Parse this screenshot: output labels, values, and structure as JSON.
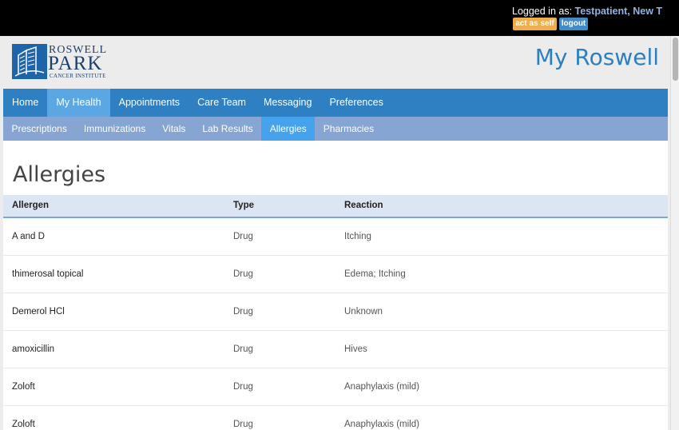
{
  "session": {
    "logged_in_label": "Logged in as:",
    "user_name": "Testpatient, New T",
    "act_as_self_label": "act as self",
    "logout_label": "logout"
  },
  "logo": {
    "line1": "ROSWELL",
    "line2": "PARK",
    "line3": "CANCER INSTITUTE"
  },
  "site_title": "My Roswell",
  "nav_primary": [
    {
      "label": "Home",
      "active": false
    },
    {
      "label": "My Health",
      "active": true
    },
    {
      "label": "Appointments",
      "active": false
    },
    {
      "label": "Care Team",
      "active": false
    },
    {
      "label": "Messaging",
      "active": false
    },
    {
      "label": "Preferences",
      "active": false
    }
  ],
  "nav_secondary": [
    {
      "label": "Prescriptions",
      "active": false
    },
    {
      "label": "Immunizations",
      "active": false
    },
    {
      "label": "Vitals",
      "active": false
    },
    {
      "label": "Lab Results",
      "active": false
    },
    {
      "label": "Allergies",
      "active": true
    },
    {
      "label": "Pharmacies",
      "active": false
    }
  ],
  "page_title": "Allergies",
  "table": {
    "headers": {
      "allergen": "Allergen",
      "type": "Type",
      "reaction": "Reaction"
    },
    "rows": [
      {
        "allergen": "A and D",
        "type": "Drug",
        "reaction": "Itching"
      },
      {
        "allergen": "thimerosal topical",
        "type": "Drug",
        "reaction": "Edema; Itching"
      },
      {
        "allergen": "Demerol HCl",
        "type": "Drug",
        "reaction": "Unknown"
      },
      {
        "allergen": "amoxicillin",
        "type": "Drug",
        "reaction": "Hives"
      },
      {
        "allergen": "Zoloft",
        "type": "Drug",
        "reaction": "Anaphylaxis (mild)"
      },
      {
        "allergen": "Zoloft",
        "type": "Drug",
        "reaction": "Anaphylaxis (mild)"
      }
    ]
  },
  "colors": {
    "primary_nav": "#2f7fc3",
    "primary_active": "#5aa7e3",
    "secondary_nav": "#86a5d2",
    "secondary_active": "#45a2ec",
    "title": "#2d7fc1",
    "act_as_self": "#f0ad4e",
    "logout": "#428bca"
  }
}
